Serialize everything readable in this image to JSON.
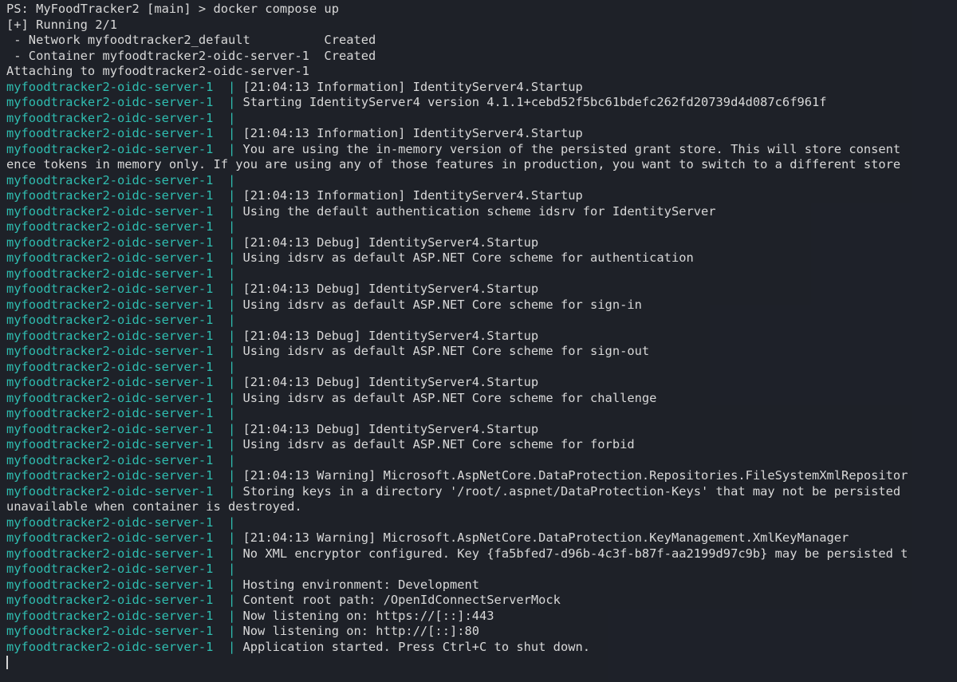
{
  "terminal": {
    "prompt": "PS: MyFoodTracker2 [main] > docker compose up",
    "header_lines": [
      "[+] Running 2/1",
      " - Network myfoodtracker2_default          Created",
      " - Container myfoodtracker2-oidc-server-1  Created",
      "Attaching to myfoodtracker2-oidc-server-1"
    ],
    "service_prefix": "myfoodtracker2-oidc-server-1  | ",
    "log_lines": [
      {
        "svc": true,
        "text": "[21:04:13 Information] IdentityServer4.Startup"
      },
      {
        "svc": true,
        "text": "Starting IdentityServer4 version 4.1.1+cebd52f5bc61bdefc262fd20739d4d087c6f961f"
      },
      {
        "svc": true,
        "text": ""
      },
      {
        "svc": true,
        "text": "[21:04:13 Information] IdentityServer4.Startup"
      },
      {
        "svc": true,
        "text": "You are using the in-memory version of the persisted grant store. This will store consent"
      },
      {
        "svc": false,
        "text": "ence tokens in memory only. If you are using any of those features in production, you want to switch to a different store"
      },
      {
        "svc": true,
        "text": ""
      },
      {
        "svc": true,
        "text": "[21:04:13 Information] IdentityServer4.Startup"
      },
      {
        "svc": true,
        "text": "Using the default authentication scheme idsrv for IdentityServer"
      },
      {
        "svc": true,
        "text": ""
      },
      {
        "svc": true,
        "text": "[21:04:13 Debug] IdentityServer4.Startup"
      },
      {
        "svc": true,
        "text": "Using idsrv as default ASP.NET Core scheme for authentication"
      },
      {
        "svc": true,
        "text": ""
      },
      {
        "svc": true,
        "text": "[21:04:13 Debug] IdentityServer4.Startup"
      },
      {
        "svc": true,
        "text": "Using idsrv as default ASP.NET Core scheme for sign-in"
      },
      {
        "svc": true,
        "text": ""
      },
      {
        "svc": true,
        "text": "[21:04:13 Debug] IdentityServer4.Startup"
      },
      {
        "svc": true,
        "text": "Using idsrv as default ASP.NET Core scheme for sign-out"
      },
      {
        "svc": true,
        "text": ""
      },
      {
        "svc": true,
        "text": "[21:04:13 Debug] IdentityServer4.Startup"
      },
      {
        "svc": true,
        "text": "Using idsrv as default ASP.NET Core scheme for challenge"
      },
      {
        "svc": true,
        "text": ""
      },
      {
        "svc": true,
        "text": "[21:04:13 Debug] IdentityServer4.Startup"
      },
      {
        "svc": true,
        "text": "Using idsrv as default ASP.NET Core scheme for forbid"
      },
      {
        "svc": true,
        "text": ""
      },
      {
        "svc": true,
        "text": "[21:04:13 Warning] Microsoft.AspNetCore.DataProtection.Repositories.FileSystemXmlRepositor"
      },
      {
        "svc": true,
        "text": "Storing keys in a directory '/root/.aspnet/DataProtection-Keys' that may not be persisted"
      },
      {
        "svc": false,
        "text": "unavailable when container is destroyed."
      },
      {
        "svc": true,
        "text": ""
      },
      {
        "svc": true,
        "text": "[21:04:13 Warning] Microsoft.AspNetCore.DataProtection.KeyManagement.XmlKeyManager"
      },
      {
        "svc": true,
        "text": "No XML encryptor configured. Key {fa5bfed7-d96b-4c3f-b87f-aa2199d97c9b} may be persisted t"
      },
      {
        "svc": true,
        "text": ""
      },
      {
        "svc": true,
        "text": "Hosting environment: Development"
      },
      {
        "svc": true,
        "text": "Content root path: /OpenIdConnectServerMock"
      },
      {
        "svc": true,
        "text": "Now listening on: https://[::]:443"
      },
      {
        "svc": true,
        "text": "Now listening on: http://[::]:80"
      },
      {
        "svc": true,
        "text": "Application started. Press Ctrl+C to shut down."
      }
    ]
  },
  "colors": {
    "background": "#1e2129",
    "service_prefix": "#2fbdb0",
    "text": "#d8d8d8"
  }
}
